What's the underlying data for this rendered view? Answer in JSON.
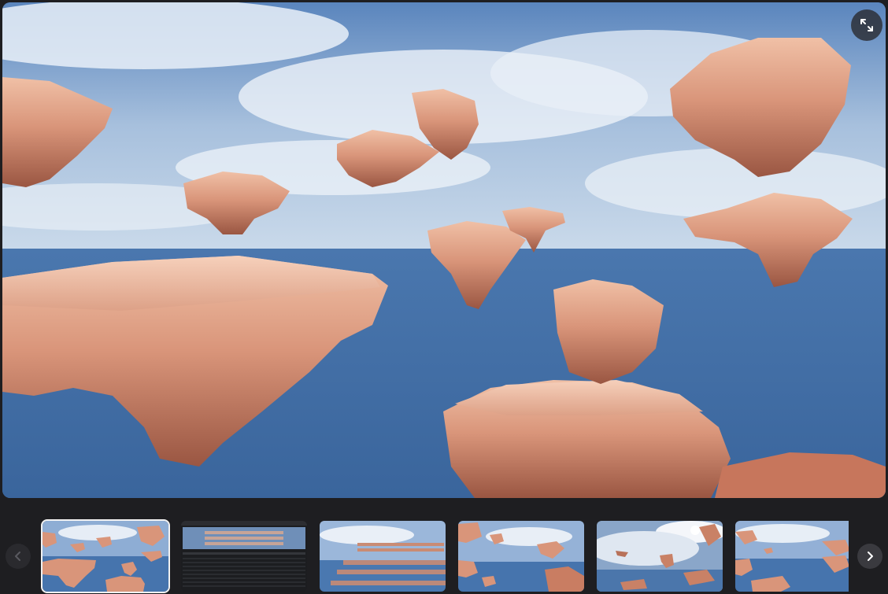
{
  "viewer": {
    "main_image": {
      "icon": "floating-rock-islands-scene",
      "sky_colors": [
        "#5c86bf",
        "#a9c3e0",
        "#3e6aa3"
      ],
      "rock_color": "#d9957a"
    },
    "fullscreen_icon": "expand-icon",
    "prev_icon": "chevron-left-icon",
    "next_icon": "chevron-right-icon",
    "active_index": 0,
    "thumbnails": [
      {
        "icon": "floating-islands-thumbnail",
        "variant": "islands"
      },
      {
        "icon": "editor-screenshot-thumbnail",
        "variant": "editor"
      },
      {
        "icon": "rock-grid-thumbnail",
        "variant": "grid"
      },
      {
        "icon": "floating-islands-thumbnail",
        "variant": "islands2"
      },
      {
        "icon": "sunlit-islands-thumbnail",
        "variant": "sun"
      },
      {
        "icon": "floating-islands-thumbnail",
        "variant": "islands3"
      }
    ]
  }
}
